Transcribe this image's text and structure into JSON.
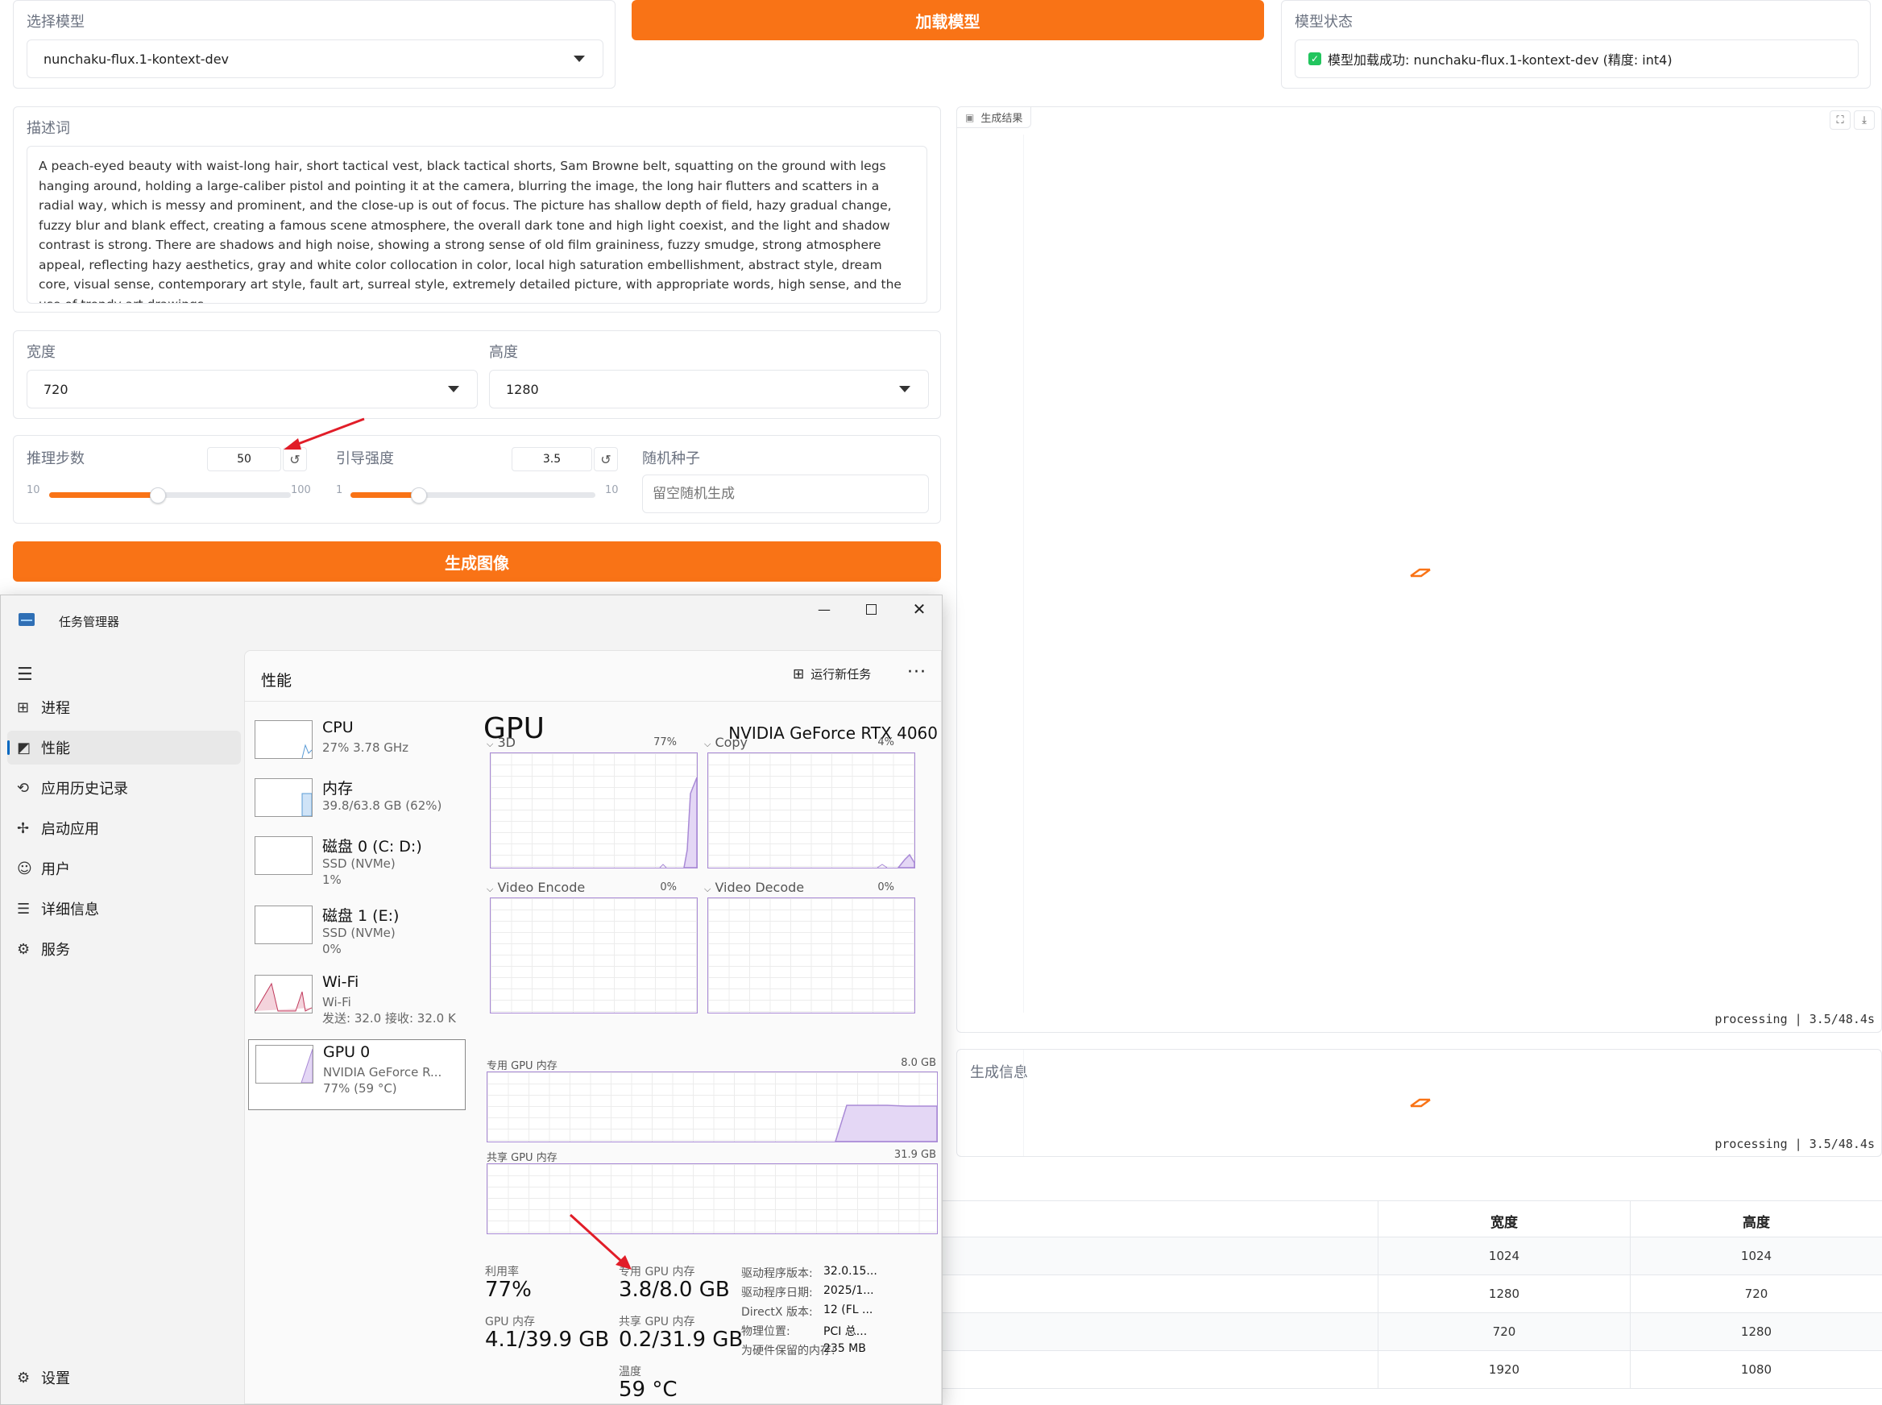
{
  "model_select": {
    "label": "选择模型",
    "value": "nunchaku-flux.1-kontext-dev"
  },
  "load_button": "加载模型",
  "model_status": {
    "label": "模型状态",
    "text": "模型加载成功: nunchaku-flux.1-kontext-dev (精度: int4)"
  },
  "prompt": {
    "label": "描述词",
    "text": "A peach-eyed beauty with waist-long hair, short tactical vest, black tactical shorts, Sam Browne belt, squatting on the ground with legs hanging around, holding a large-caliber pistol and pointing it at the camera, blurring the image, the long hair flutters and scatters in a radial way, which is messy and prominent, and the close-up is out of focus. The picture has shallow depth of field, hazy gradual change, fuzzy blur and blank effect, creating a famous scene atmosphere, the overall dark tone and high light coexist, and the light and shadow contrast is strong. There are shadows and high noise, showing a strong sense of old film graininess, fuzzy smudge, strong atmosphere appeal, reflecting hazy aesthetics, gray and white color collocation in color, local high saturation embellishment, abstract style, dream core, visual sense, contemporary art style, fault art, surreal style, extremely detailed picture, with appropriate words, high sense, and the use of trendy art drawings."
  },
  "width": {
    "label": "宽度",
    "value": "720"
  },
  "height": {
    "label": "高度",
    "value": "1280"
  },
  "steps": {
    "label": "推理步数",
    "value": "50",
    "min": "10",
    "max": "100",
    "level": 0.45
  },
  "guidance": {
    "label": "引导强度",
    "value": "3.5",
    "min": "1",
    "max": "10",
    "level": 0.28
  },
  "seed": {
    "label": "随机种子",
    "placeholder": "留空随机生成"
  },
  "generate_button": "生成图像",
  "result": {
    "label": "生成结果",
    "progress": "processing | 3.5/48.4s"
  },
  "info": {
    "label": "生成信息",
    "progress": "processing | 3.5/48.4s"
  },
  "size_table": {
    "headers": [
      "宽度",
      "高度"
    ],
    "rows": [
      [
        "1024",
        "1024"
      ],
      [
        "1280",
        "720"
      ],
      [
        "720",
        "1280"
      ],
      [
        "1920",
        "1080"
      ]
    ]
  },
  "task_manager": {
    "title": "任务管理器",
    "nav": [
      "进程",
      "性能",
      "应用历史记录",
      "启动应用",
      "用户",
      "详细信息",
      "服务"
    ],
    "settings": "设置",
    "header": "性能",
    "run_task": "运行新任务",
    "resources": [
      {
        "title": "CPU",
        "sub1": "27% 3.78 GHz",
        "sub2": "",
        "sub3": ""
      },
      {
        "title": "内存",
        "sub1": "39.8/63.8 GB (62%)",
        "sub2": "",
        "sub3": ""
      },
      {
        "title": "磁盘 0 (C: D:)",
        "sub1": "SSD (NVMe)",
        "sub2": "1%",
        "sub3": ""
      },
      {
        "title": "磁盘 1 (E:)",
        "sub1": "SSD (NVMe)",
        "sub2": "0%",
        "sub3": ""
      },
      {
        "title": "Wi-Fi",
        "sub1": "Wi-Fi",
        "sub2": "发送: 32.0 接收: 32.0 K",
        "sub3": ""
      },
      {
        "title": "GPU 0",
        "sub1": "NVIDIA GeForce R...",
        "sub2": "77% (59 °C)",
        "sub3": ""
      }
    ],
    "gpu": {
      "title": "GPU",
      "name": "NVIDIA GeForce RTX 4060",
      "engines": [
        {
          "label": "3D",
          "pct": "77%"
        },
        {
          "label": "Copy",
          "pct": "4%"
        },
        {
          "label": "Video Encode",
          "pct": "0%"
        },
        {
          "label": "Video Decode",
          "pct": "0%"
        }
      ],
      "dedicated": {
        "label": "专用 GPU 内存",
        "max": "8.0 GB"
      },
      "shared": {
        "label": "共享 GPU 内存",
        "max": "31.9 GB"
      },
      "stats": {
        "util_l": "利用率",
        "util_v": "77%",
        "ded_l": "专用 GPU 内存",
        "ded_v": "3.8/8.0 GB",
        "gpumem_l": "GPU 内存",
        "gpumem_v": "4.1/39.9 GB",
        "shared_l": "共享 GPU 内存",
        "shared_v": "0.2/31.9 GB",
        "temp_l": "温度",
        "temp_v": "59 °C"
      },
      "info": [
        {
          "k": "驱动程序版本:",
          "v": "32.0.15..."
        },
        {
          "k": "驱动程序日期:",
          "v": "2025/1..."
        },
        {
          "k": "DirectX 版本:",
          "v": "12 (FL ..."
        },
        {
          "k": "物理位置:",
          "v": "PCI 总..."
        },
        {
          "k": "为硬件保留的内存:",
          "v": "235 MB"
        }
      ]
    }
  },
  "colors": {
    "accent": "#f97316",
    "gpu_graph": "#a98ad6",
    "checkbox": "#22c55e"
  }
}
